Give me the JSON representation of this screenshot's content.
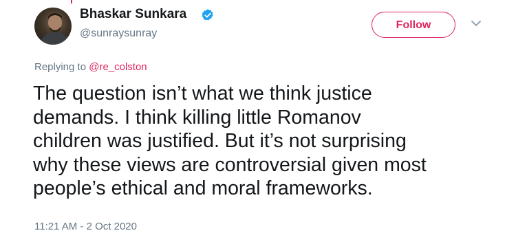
{
  "colors": {
    "accent": "#e0245e",
    "verified": "#1da1f2",
    "text_primary": "#14171a",
    "text_secondary": "#657786"
  },
  "author": {
    "display_name": "Bhaskar Sunkara",
    "handle": "@sunraysunray",
    "verified": true,
    "verified_icon": "verified-badge-icon",
    "avatar": "user-avatar"
  },
  "actions": {
    "follow_label": "Follow",
    "more_icon": "chevron-down-icon"
  },
  "reply": {
    "prefix": "Replying to",
    "mention": "@re_colston"
  },
  "tweet": {
    "lines": [
      "The question isn’t what we think justice",
      "demands. I think killing little Romanov",
      "children was justified. But it’s not surprising",
      "why these views are controversial given most",
      "people’s ethical and moral frameworks."
    ],
    "timestamp": "11:21 AM - 2 Oct 2020"
  }
}
